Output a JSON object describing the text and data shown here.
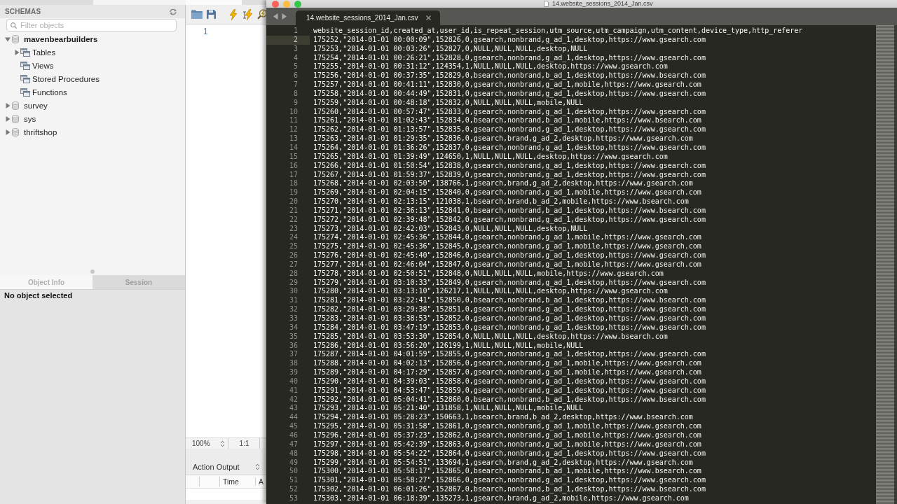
{
  "workbench": {
    "schemas_panel": {
      "title": "SCHEMAS",
      "filter": {
        "placeholder": "Filter objects"
      },
      "tree": [
        {
          "label": "mavenbearbuilders",
          "default": true,
          "expanded": true,
          "children": [
            {
              "label": "Tables",
              "expanded": false
            },
            {
              "label": "Views"
            },
            {
              "label": "Stored Procedures"
            },
            {
              "label": "Functions"
            }
          ]
        },
        {
          "label": "survey",
          "default": false,
          "expanded": false
        },
        {
          "label": "sys",
          "default": false,
          "expanded": false
        },
        {
          "label": "thriftshop",
          "default": false,
          "expanded": false
        }
      ]
    },
    "info_panel": {
      "tabs": [
        {
          "label": "Object Info",
          "selected": true
        },
        {
          "label": "Session",
          "selected": false
        }
      ],
      "message": "No object selected"
    },
    "query_editor": {
      "line_numbers": [
        "1"
      ],
      "status_bar": {
        "zoom": "100%",
        "ratio": "1:1"
      }
    },
    "output_panel": {
      "mode": "Action Output",
      "columns": [
        "Time",
        "A"
      ]
    }
  },
  "sublime": {
    "title": "14.website_sessions_2014_Jan.csv",
    "tabs": [
      {
        "label": "14.website_sessions_2014_Jan.csv",
        "selected": true
      }
    ],
    "lines": [
      {
        "number": "1",
        "text": "website_session_id,created_at,user_id,is_repeat_session,utm_source,utm_campaign,utm_content,device_type,http_referer",
        "current": false
      },
      {
        "number": "2",
        "text": "175252,\"2014-01-01 00:00:09\",152826,0,gsearch,nonbrand,g_ad_1,desktop,https://www.gsearch.com",
        "current": true
      },
      {
        "number": "3",
        "text": "175253,\"2014-01-01 00:03:26\",152827,0,NULL,NULL,NULL,desktop,NULL",
        "current": false
      },
      {
        "number": "4",
        "text": "175254,\"2014-01-01 00:26:21\",152828,0,gsearch,nonbrand,g_ad_1,desktop,https://www.gsearch.com",
        "current": false
      },
      {
        "number": "5",
        "text": "175255,\"2014-01-01 00:31:12\",124354,1,NULL,NULL,NULL,desktop,https://www.gsearch.com",
        "current": false
      },
      {
        "number": "6",
        "text": "175256,\"2014-01-01 00:37:35\",152829,0,bsearch,nonbrand,b_ad_1,desktop,https://www.bsearch.com",
        "current": false
      },
      {
        "number": "7",
        "text": "175257,\"2014-01-01 00:41:11\",152830,0,gsearch,nonbrand,g_ad_1,mobile,https://www.gsearch.com",
        "current": false
      },
      {
        "number": "8",
        "text": "175258,\"2014-01-01 00:44:49\",152831,0,gsearch,nonbrand,g_ad_1,desktop,https://www.gsearch.com",
        "current": false
      },
      {
        "number": "9",
        "text": "175259,\"2014-01-01 00:48:18\",152832,0,NULL,NULL,NULL,mobile,NULL",
        "current": false
      },
      {
        "number": "10",
        "text": "175260,\"2014-01-01 00:57:47\",152833,0,gsearch,nonbrand,g_ad_1,desktop,https://www.gsearch.com",
        "current": false
      },
      {
        "number": "11",
        "text": "175261,\"2014-01-01 01:02:43\",152834,0,bsearch,nonbrand,b_ad_1,mobile,https://www.bsearch.com",
        "current": false
      },
      {
        "number": "12",
        "text": "175262,\"2014-01-01 01:13:57\",152835,0,gsearch,nonbrand,g_ad_1,desktop,https://www.gsearch.com",
        "current": false
      },
      {
        "number": "13",
        "text": "175263,\"2014-01-01 01:29:35\",152836,0,gsearch,brand,g_ad_2,desktop,https://www.gsearch.com",
        "current": false
      },
      {
        "number": "14",
        "text": "175264,\"2014-01-01 01:36:26\",152837,0,gsearch,nonbrand,g_ad_1,desktop,https://www.gsearch.com",
        "current": false
      },
      {
        "number": "15",
        "text": "175265,\"2014-01-01 01:39:49\",124650,1,NULL,NULL,NULL,desktop,https://www.gsearch.com",
        "current": false
      },
      {
        "number": "16",
        "text": "175266,\"2014-01-01 01:50:54\",152838,0,gsearch,nonbrand,g_ad_1,desktop,https://www.gsearch.com",
        "current": false
      },
      {
        "number": "17",
        "text": "175267,\"2014-01-01 01:59:37\",152839,0,gsearch,nonbrand,g_ad_1,desktop,https://www.gsearch.com",
        "current": false
      },
      {
        "number": "18",
        "text": "175268,\"2014-01-01 02:03:50\",138766,1,gsearch,brand,g_ad_2,desktop,https://www.gsearch.com",
        "current": false
      },
      {
        "number": "19",
        "text": "175269,\"2014-01-01 02:04:15\",152840,0,gsearch,nonbrand,g_ad_1,mobile,https://www.gsearch.com",
        "current": false
      },
      {
        "number": "20",
        "text": "175270,\"2014-01-01 02:13:15\",121038,1,bsearch,brand,b_ad_2,mobile,https://www.bsearch.com",
        "current": false
      },
      {
        "number": "21",
        "text": "175271,\"2014-01-01 02:36:13\",152841,0,bsearch,nonbrand,b_ad_1,desktop,https://www.bsearch.com",
        "current": false
      },
      {
        "number": "22",
        "text": "175272,\"2014-01-01 02:39:48\",152842,0,gsearch,nonbrand,g_ad_1,desktop,https://www.gsearch.com",
        "current": false
      },
      {
        "number": "23",
        "text": "175273,\"2014-01-01 02:42:03\",152843,0,NULL,NULL,NULL,desktop,NULL",
        "current": false
      },
      {
        "number": "24",
        "text": "175274,\"2014-01-01 02:45:36\",152844,0,gsearch,nonbrand,g_ad_1,mobile,https://www.gsearch.com",
        "current": false
      },
      {
        "number": "25",
        "text": "175275,\"2014-01-01 02:45:36\",152845,0,gsearch,nonbrand,g_ad_1,mobile,https://www.gsearch.com",
        "current": false
      },
      {
        "number": "26",
        "text": "175276,\"2014-01-01 02:45:40\",152846,0,gsearch,nonbrand,g_ad_1,desktop,https://www.gsearch.com",
        "current": false
      },
      {
        "number": "27",
        "text": "175277,\"2014-01-01 02:46:04\",152847,0,gsearch,nonbrand,g_ad_1,mobile,https://www.gsearch.com",
        "current": false
      },
      {
        "number": "28",
        "text": "175278,\"2014-01-01 02:50:51\",152848,0,NULL,NULL,NULL,mobile,https://www.gsearch.com",
        "current": false
      },
      {
        "number": "29",
        "text": "175279,\"2014-01-01 03:10:33\",152849,0,gsearch,nonbrand,g_ad_1,desktop,https://www.gsearch.com",
        "current": false
      },
      {
        "number": "30",
        "text": "175280,\"2014-01-01 03:13:10\",126217,1,NULL,NULL,NULL,desktop,https://www.gsearch.com",
        "current": false
      },
      {
        "number": "31",
        "text": "175281,\"2014-01-01 03:22:41\",152850,0,bsearch,nonbrand,b_ad_1,desktop,https://www.bsearch.com",
        "current": false
      },
      {
        "number": "32",
        "text": "175282,\"2014-01-01 03:29:38\",152851,0,gsearch,nonbrand,g_ad_1,desktop,https://www.gsearch.com",
        "current": false
      },
      {
        "number": "33",
        "text": "175283,\"2014-01-01 03:38:53\",152852,0,gsearch,nonbrand,g_ad_1,desktop,https://www.gsearch.com",
        "current": false
      },
      {
        "number": "34",
        "text": "175284,\"2014-01-01 03:47:19\",152853,0,gsearch,nonbrand,g_ad_1,desktop,https://www.gsearch.com",
        "current": false
      },
      {
        "number": "35",
        "text": "175285,\"2014-01-01 03:53:30\",152854,0,NULL,NULL,NULL,desktop,https://www.bsearch.com",
        "current": false
      },
      {
        "number": "36",
        "text": "175286,\"2014-01-01 03:56:20\",126199,1,NULL,NULL,NULL,mobile,NULL",
        "current": false
      },
      {
        "number": "37",
        "text": "175287,\"2014-01-01 04:01:59\",152855,0,gsearch,nonbrand,g_ad_1,desktop,https://www.gsearch.com",
        "current": false
      },
      {
        "number": "38",
        "text": "175288,\"2014-01-01 04:02:13\",152856,0,gsearch,nonbrand,g_ad_1,mobile,https://www.gsearch.com",
        "current": false
      },
      {
        "number": "39",
        "text": "175289,\"2014-01-01 04:17:29\",152857,0,gsearch,nonbrand,g_ad_1,mobile,https://www.gsearch.com",
        "current": false
      },
      {
        "number": "40",
        "text": "175290,\"2014-01-01 04:39:03\",152858,0,gsearch,nonbrand,g_ad_1,desktop,https://www.gsearch.com",
        "current": false
      },
      {
        "number": "41",
        "text": "175291,\"2014-01-01 04:53:47\",152859,0,gsearch,nonbrand,g_ad_1,desktop,https://www.gsearch.com",
        "current": false
      },
      {
        "number": "42",
        "text": "175292,\"2014-01-01 05:04:41\",152860,0,bsearch,nonbrand,b_ad_1,desktop,https://www.bsearch.com",
        "current": false
      },
      {
        "number": "43",
        "text": "175293,\"2014-01-01 05:21:40\",131858,1,NULL,NULL,NULL,mobile,NULL",
        "current": false
      },
      {
        "number": "44",
        "text": "175294,\"2014-01-01 05:28:23\",150663,1,bsearch,brand,b_ad_2,desktop,https://www.bsearch.com",
        "current": false
      },
      {
        "number": "45",
        "text": "175295,\"2014-01-01 05:31:58\",152861,0,gsearch,nonbrand,g_ad_1,mobile,https://www.gsearch.com",
        "current": false
      },
      {
        "number": "46",
        "text": "175296,\"2014-01-01 05:37:23\",152862,0,gsearch,nonbrand,g_ad_1,mobile,https://www.gsearch.com",
        "current": false
      },
      {
        "number": "47",
        "text": "175297,\"2014-01-01 05:42:39\",152863,0,gsearch,nonbrand,g_ad_1,mobile,https://www.gsearch.com",
        "current": false
      },
      {
        "number": "48",
        "text": "175298,\"2014-01-01 05:54:22\",152864,0,gsearch,nonbrand,g_ad_1,desktop,https://www.gsearch.com",
        "current": false
      },
      {
        "number": "49",
        "text": "175299,\"2014-01-01 05:54:51\",133694,1,gsearch,brand,g_ad_2,desktop,https://www.gsearch.com",
        "current": false
      },
      {
        "number": "50",
        "text": "175300,\"2014-01-01 05:58:17\",152865,0,bsearch,nonbrand,b_ad_1,mobile,https://www.bsearch.com",
        "current": false
      },
      {
        "number": "51",
        "text": "175301,\"2014-01-01 05:58:27\",152866,0,gsearch,nonbrand,g_ad_1,desktop,https://www.gsearch.com",
        "current": false
      },
      {
        "number": "52",
        "text": "175302,\"2014-01-01 06:01:26\",152867,0,bsearch,nonbrand,b_ad_1,desktop,https://www.bsearch.com",
        "current": false
      },
      {
        "number": "53",
        "text": "175303,\"2014-01-01 06:18:39\",135273,1,gsearch,brand,g_ad_2,mobile,https://www.gsearch.com",
        "current": false
      }
    ]
  }
}
